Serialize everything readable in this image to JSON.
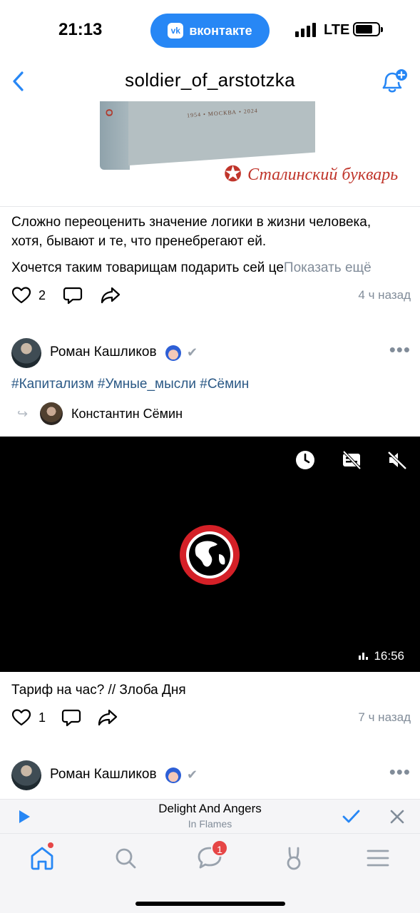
{
  "status_bar": {
    "time": "21:13",
    "app_pill": "вконтакте",
    "app_pill_logo": "vk",
    "network": "LTE"
  },
  "header": {
    "title": "soldier_of_arstotzka"
  },
  "book_image": {
    "spine_text": "O",
    "cover_text": "1954 • МОСКВА • 2024",
    "brand_text": "Сталинский букварь"
  },
  "post1": {
    "text_line1": "Сложно переоценить значение логики в жизни человека,",
    "text_line2": "хотя, бывают и те, что пренебрегают ей.",
    "text_line3": "Хочется таким товарищам подарить сей це",
    "show_more": "Показать ещё",
    "likes": "2",
    "time_ago": "4 ч назад"
  },
  "post2": {
    "author": "Роман Кашликов",
    "hashtags": [
      "#Капитализм",
      "#Умные_мысли",
      "#Сёмин"
    ],
    "repost_author": "Константин Сёмин",
    "video_duration": "16:56",
    "caption": "Тариф на час? // Злоба Дня",
    "likes": "1",
    "time_ago": "7 ч назад"
  },
  "post3": {
    "author": "Роман Кашликов"
  },
  "mini_player": {
    "title": "Delight And Angers",
    "artist": "In Flames"
  },
  "tab_bar": {
    "messages_badge": "1"
  },
  "colors": {
    "accent": "#2787f5",
    "link": "#2a5885",
    "secondary_text": "#818c99",
    "badge": "#e64646"
  }
}
